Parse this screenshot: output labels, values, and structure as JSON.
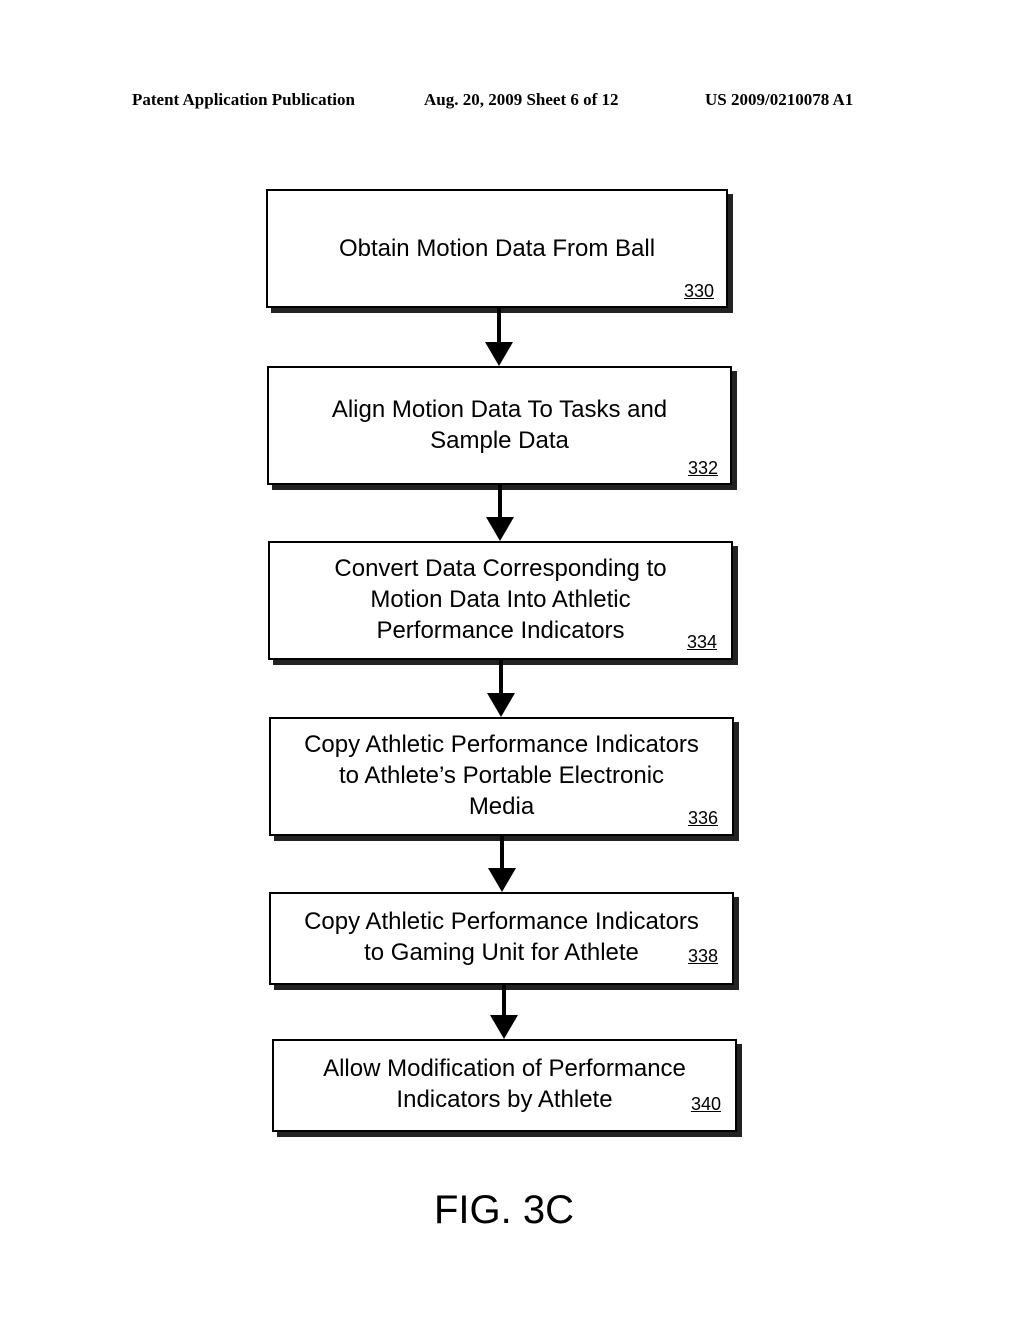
{
  "header": {
    "publication": "Patent Application Publication",
    "date_sheet": "Aug. 20, 2009  Sheet 6 of 12",
    "patent_number": "US 2009/0210078 A1"
  },
  "flowchart": {
    "steps": [
      {
        "label": "Obtain Motion Data From Ball",
        "ref": "330"
      },
      {
        "label": "Align Motion Data To Tasks and\nSample Data",
        "ref": "332"
      },
      {
        "label": "Convert Data Corresponding to\nMotion Data Into Athletic\nPerformance Indicators",
        "ref": "334"
      },
      {
        "label": "Copy Athletic Performance Indicators\nto Athlete’s Portable Electronic\nMedia",
        "ref": "336"
      },
      {
        "label": "Copy Athletic Performance Indicators\nto Gaming Unit for Athlete",
        "ref": "338"
      },
      {
        "label": "Allow Modification of Performance\nIndicators by Athlete",
        "ref": "340"
      }
    ],
    "connections": [
      {
        "from": "330",
        "to": "332"
      },
      {
        "from": "332",
        "to": "334"
      },
      {
        "from": "334",
        "to": "336"
      },
      {
        "from": "336",
        "to": "338"
      },
      {
        "from": "338",
        "to": "340"
      }
    ]
  },
  "figure_label": "FIG. 3C"
}
